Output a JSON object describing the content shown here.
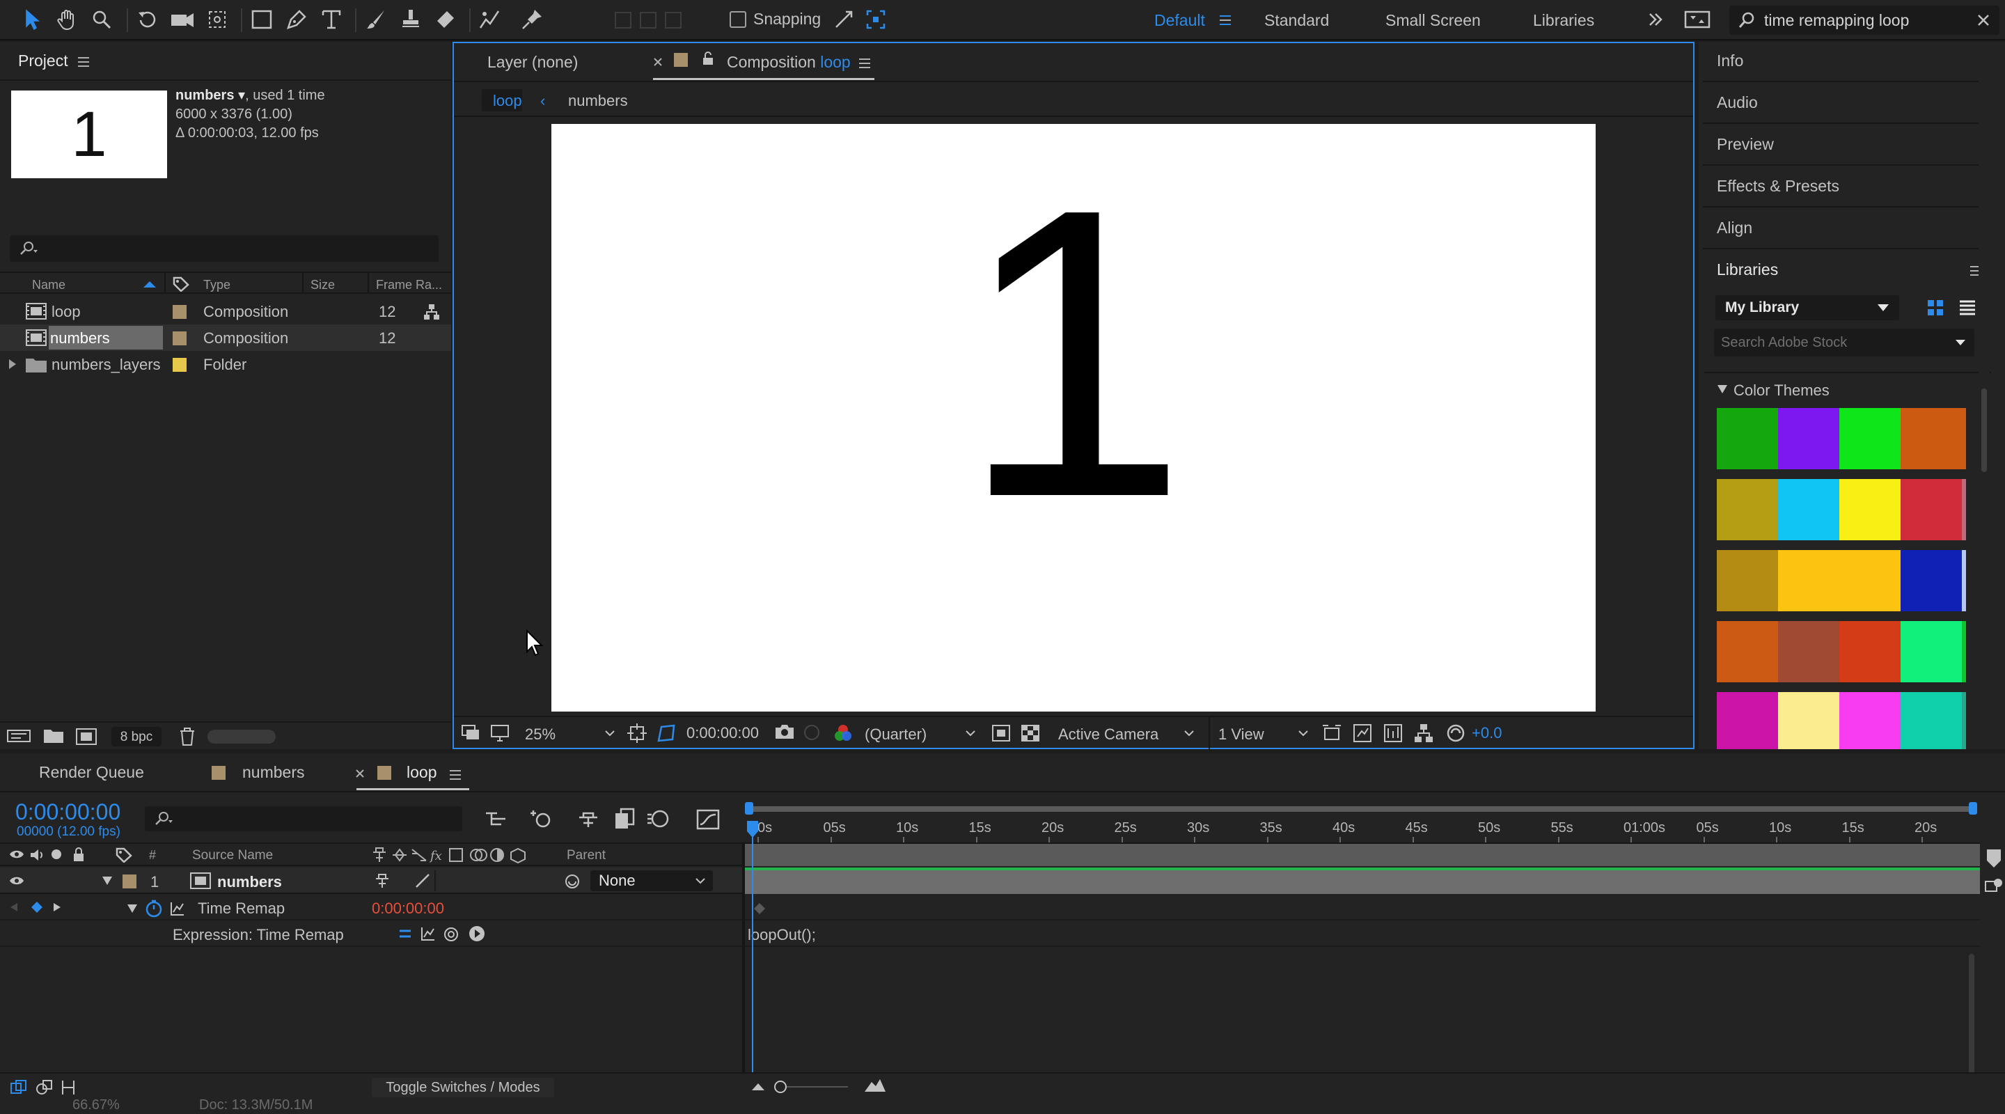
{
  "workspaces": {
    "items": [
      "Default",
      "Standard",
      "Small Screen",
      "Libraries"
    ],
    "active": "Default"
  },
  "toolbar": {
    "snapping_label": "Snapping",
    "search_value": "time remapping loop"
  },
  "project": {
    "title": "Project",
    "preview_digit": "1",
    "info_name": "numbers",
    "info_used": ", used 1 time",
    "info_dims": "6000 x 3376 (1.00)",
    "info_duration": "Δ 0:00:00:03, 12.00 fps",
    "columns": [
      "Name",
      "Type",
      "Size",
      "Frame Ra..."
    ],
    "items": [
      {
        "name": "loop",
        "type": "Composition",
        "size": "",
        "fps": "12",
        "color": "#a8906a"
      },
      {
        "name": "numbers",
        "type": "Composition",
        "size": "",
        "fps": "12",
        "color": "#a8906a"
      },
      {
        "name": "numbers_layers",
        "type": "Folder",
        "size": "",
        "fps": "",
        "color": "#e6c84b"
      }
    ],
    "bpc": "8 bpc"
  },
  "viewer": {
    "layer_tab": "Layer (none)",
    "comp_tab_prefix": "Composition",
    "comp_tab_name": "loop",
    "breadcrumb_active": "loop",
    "breadcrumb_next": "numbers",
    "canvas_digit": "1",
    "zoom": "25%",
    "timecode": "0:00:00:00",
    "resolution": "(Quarter)",
    "camera": "Active Camera",
    "view": "1 View",
    "exposure": "+0.0"
  },
  "right_panel": {
    "items": [
      "Info",
      "Audio",
      "Preview",
      "Effects & Presets",
      "Align",
      "Libraries"
    ],
    "library": "My Library",
    "stock_placeholder": "Search Adobe Stock",
    "color_themes_label": "Color Themes",
    "themes": [
      [
        "#15a80e",
        "#7d18f0",
        "#0ee61a",
        "#cc5a10",
        "#cc5a18"
      ],
      [
        "#b49e14",
        "#10c4f4",
        "#f8f014",
        "#d02c3a",
        "#c06a7c"
      ],
      [
        "#b48c14",
        "#fcc410",
        "#fcc410",
        "#1022b4",
        "#b4c8f8"
      ],
      [
        "#cc5a14",
        "#a04a34",
        "#d43c18",
        "#10f07a",
        "#10c430"
      ],
      [
        "#cc14a8",
        "#fcec90",
        "#f83cf0",
        "#10d0ac",
        "#28a888"
      ]
    ]
  },
  "timeline": {
    "tabs": {
      "render_queue": "Render Queue",
      "numbers": "numbers",
      "loop": "loop"
    },
    "timecode": "0:00:00:00",
    "frames": "00000 (12.00 fps)",
    "col_source": "Source Name",
    "col_parent": "Parent",
    "layer_num": "1",
    "layer_name": "numbers",
    "parent_value": "None",
    "prop_time_remap": "Time Remap",
    "prop_time_value": "0:00:00:00",
    "prop_expression": "Expression: Time Remap",
    "expression_text": "loopOut();",
    "ruler": [
      "0s",
      "05s",
      "10s",
      "15s",
      "20s",
      "25s",
      "30s",
      "35s",
      "40s",
      "45s",
      "50s",
      "55s",
      "01:00s",
      "05s",
      "10s",
      "15s",
      "20s"
    ],
    "toggle_label": "Toggle Switches / Modes",
    "status_left": "66.67%",
    "status_doc": "Doc: 13.3M/50.1M"
  }
}
